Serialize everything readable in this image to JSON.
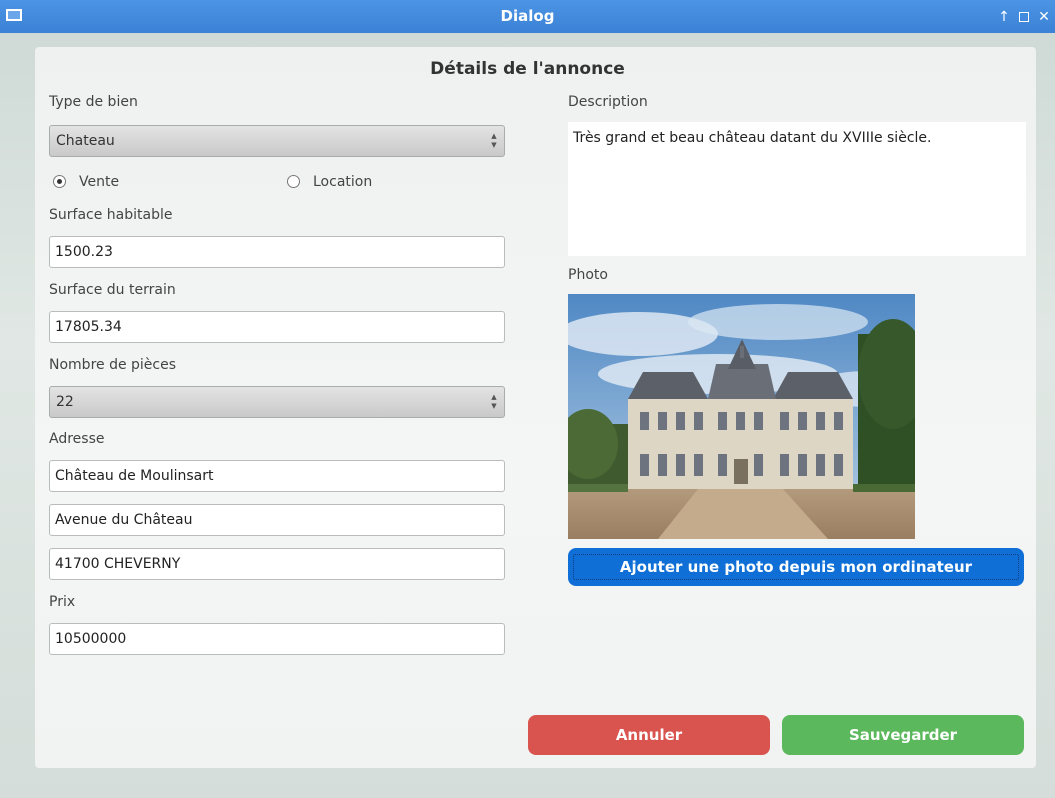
{
  "window": {
    "title": "Dialog"
  },
  "form": {
    "heading": "Détails de l'annonce",
    "type_label": "Type de bien",
    "type_value": "Chateau",
    "transaction": {
      "option_sale": "Vente",
      "option_rent": "Location",
      "selected": "Vente"
    },
    "surface_label": "Surface habitable",
    "surface_value": "1500.23",
    "land_label": "Surface du terrain",
    "land_value": "17805.34",
    "rooms_label": "Nombre de pièces",
    "rooms_value": "22",
    "address_label": "Adresse",
    "address_line1": "Château de Moulinsart",
    "address_line2": "Avenue du Château",
    "address_line3": "41700 CHEVERNY",
    "price_label": "Prix",
    "price_value": "10500000",
    "description_label": "Description",
    "description_value": "Très grand et beau château datant du XVIIIe siècle.",
    "photo_label": "Photo",
    "add_photo_button": "Ajouter une photo depuis mon ordinateur",
    "cancel_button": "Annuler",
    "save_button": "Sauvegarder"
  },
  "colors": {
    "titlebar": "#3b82d6",
    "add_photo_button": "#0f6fd6",
    "cancel_button": "#d9534f",
    "save_button": "#5cb85c"
  }
}
